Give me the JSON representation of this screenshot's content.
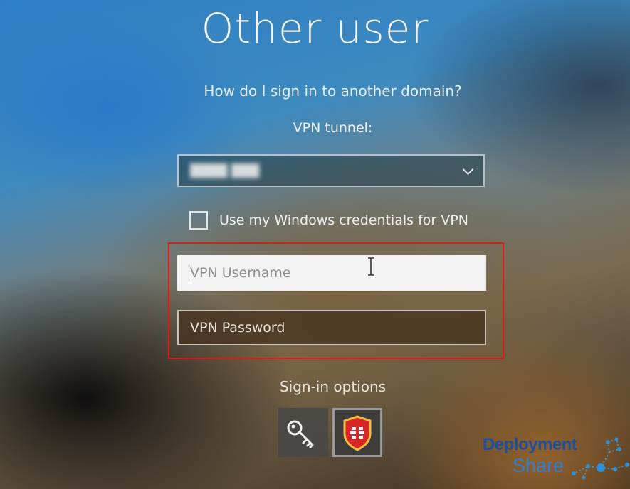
{
  "header": {
    "title": "Other user",
    "domain_link": "How do I sign in to another domain?"
  },
  "vpn": {
    "tunnel_label": "VPN tunnel:",
    "tunnel_value": "████ ███",
    "use_windows_credentials_label": "Use my Windows credentials for VPN",
    "use_windows_credentials_checked": false,
    "username_placeholder": "VPN Username",
    "password_placeholder": "VPN Password",
    "highlight_color": "#e01818"
  },
  "signin": {
    "options_label": "Sign-in options",
    "options": [
      {
        "icon": "key-icon"
      },
      {
        "icon": "fortinet-shield-icon"
      }
    ]
  },
  "watermark": {
    "line1": "Deployment",
    "line2": "Share"
  }
}
